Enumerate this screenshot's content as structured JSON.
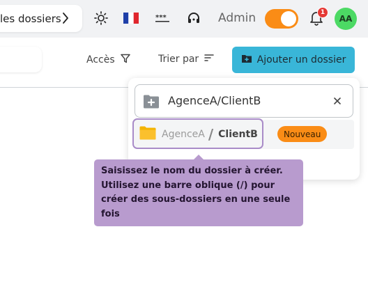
{
  "topbar": {
    "breadcrumb_label": "les dossiers",
    "admin_label": "Admin",
    "notification_count": "1",
    "avatar_initials": "AA",
    "theme_toggle_on": true,
    "accent_color": "#fa8c16"
  },
  "toolbar": {
    "access_label": "Accès",
    "sort_label": "Trier par",
    "add_folder_label": "Ajouter un dossier"
  },
  "folder_popup": {
    "input_value": "AgenceA/ClientB",
    "suggestion": {
      "parent": "AgenceA",
      "separator": "/",
      "leaf": "ClientB",
      "badge": "Nouveau"
    }
  },
  "tooltip": {
    "text": "Saisissez le nom du dossier à créer. Utilisez une barre oblique (/) pour créer des sous-dossiers en une seule fois"
  },
  "icons": [
    "chevron-right-icon",
    "sun-icon",
    "france-flag-icon",
    "password-icon",
    "headset-icon",
    "bell-icon",
    "filter-icon",
    "sort-icon",
    "folder-add-icon",
    "folder-plus-icon",
    "close-icon",
    "folder-icon"
  ]
}
